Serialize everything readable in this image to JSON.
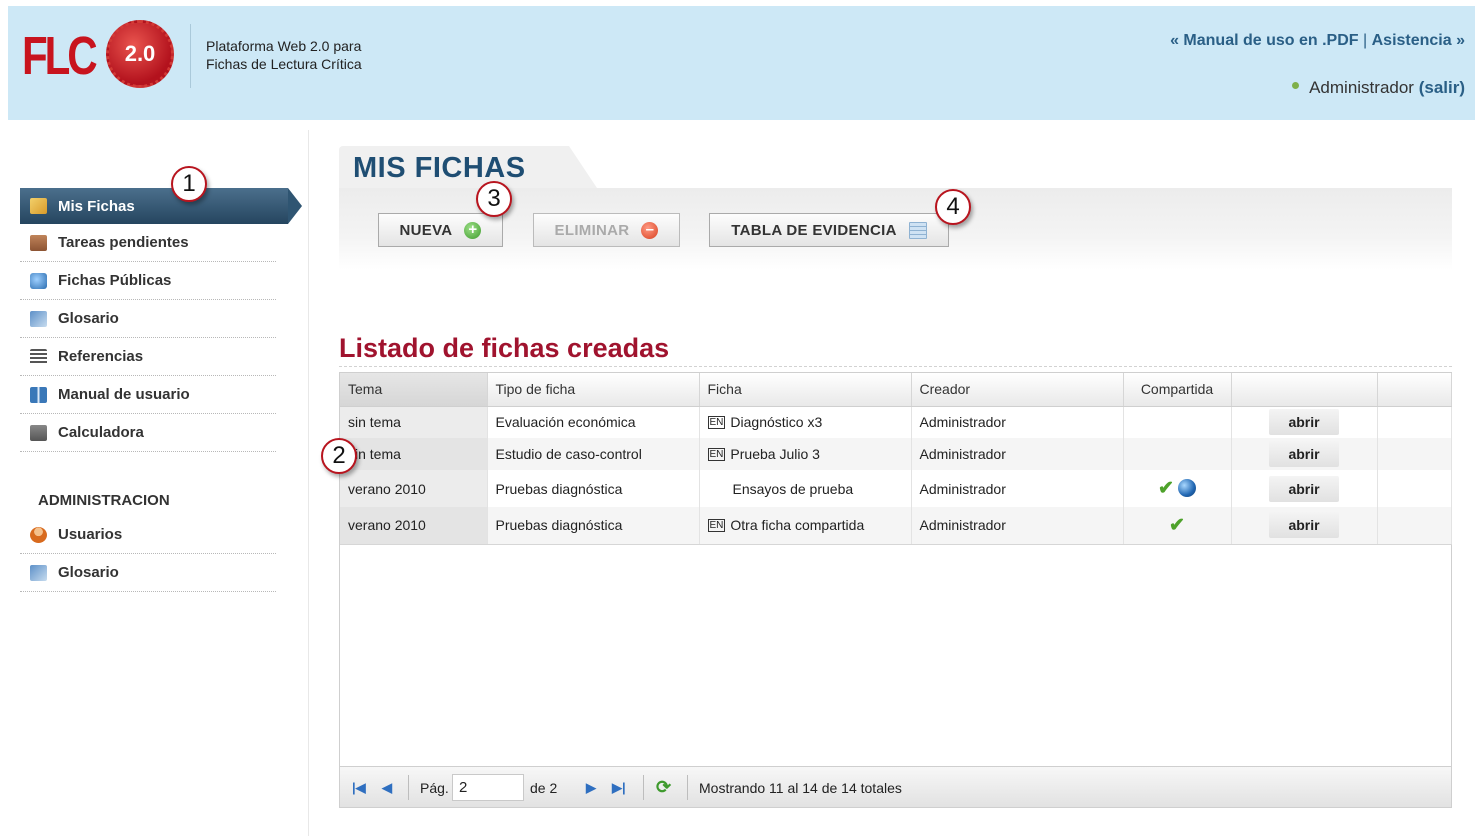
{
  "header": {
    "logo_text": "FLC",
    "logo_badge": "2.0",
    "tagline_line1": "Plataforma Web 2.0 para",
    "tagline_line2": "Fichas de Lectura Crítica",
    "manual_link": "« Manual de uso en .PDF",
    "link_separator": " | ",
    "assist_link": "Asistencia »",
    "user_name": "Administrador",
    "logout_label": "(salir)"
  },
  "sidebar": {
    "items": [
      {
        "label": "Mis Fichas",
        "icon": "fichas-icon",
        "active": true
      },
      {
        "label": "Tareas pendientes",
        "icon": "tasks-icon"
      },
      {
        "label": "Fichas Públicas",
        "icon": "public-icon"
      },
      {
        "label": "Glosario",
        "icon": "glossary-icon"
      },
      {
        "label": "Referencias",
        "icon": "references-icon"
      },
      {
        "label": "Manual de usuario",
        "icon": "manual-icon"
      },
      {
        "label": "Calculadora",
        "icon": "calculator-icon"
      }
    ],
    "admin_heading": "ADMINISTRACION",
    "admin_items": [
      {
        "label": "Usuarios",
        "icon": "users-icon"
      },
      {
        "label": "Glosario",
        "icon": "glossary-icon"
      }
    ]
  },
  "main": {
    "title": "MIS FICHAS",
    "buttons": {
      "new_label": "NUEVA",
      "delete_label": "ELIMINAR",
      "evidence_label": "TABLA DE EVIDENCIA"
    },
    "list_title": "Listado de fichas creadas"
  },
  "annotations": {
    "b1": "1",
    "b2": "2",
    "b3": "3",
    "b4": "4"
  },
  "table": {
    "columns": [
      "Tema",
      "Tipo de ficha",
      "Ficha",
      "Creador",
      "Compartida",
      ""
    ],
    "lang_tag": "EN",
    "open_label": "abrir",
    "rows": [
      {
        "tema": "sin tema",
        "tipo": "Evaluación económica",
        "ficha": "Diagnóstico x3",
        "creador": "Administrador",
        "lang": true,
        "shared": false,
        "public": false
      },
      {
        "tema": "sin tema",
        "tipo": "Estudio de caso-control",
        "ficha": "Prueba Julio 3",
        "creador": "Administrador",
        "lang": true,
        "shared": false,
        "public": false
      },
      {
        "tema": "verano 2010",
        "tipo": "Pruebas diagnóstica",
        "ficha": "Ensayos de prueba",
        "creador": "Administrador",
        "lang": false,
        "shared": true,
        "public": true
      },
      {
        "tema": "verano 2010",
        "tipo": "Pruebas diagnóstica",
        "ficha": "Otra ficha compartida",
        "creador": "Administrador",
        "lang": true,
        "shared": true,
        "public": false
      }
    ]
  },
  "pager": {
    "page_label": "Pág.",
    "page_value": "2",
    "of_label": "de 2",
    "status": "Mostrando 11 al 14 de 14 totales"
  },
  "colors": {
    "header_bg": "#cde8f6",
    "brand_red": "#c8141e",
    "title_blue": "#1f4e73",
    "list_title_red": "#a0132e",
    "link_blue": "#2a5f86"
  }
}
